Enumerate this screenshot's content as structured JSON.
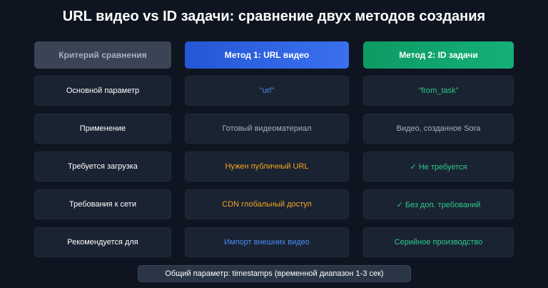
{
  "title": "URL видео vs ID задачи: сравнение двух методов создания",
  "headers": {
    "criteria": "Критерий сравнения",
    "method1": "Метод 1: URL видео",
    "method2": "Метод 2: ID задачи"
  },
  "rows": [
    {
      "criterion": "Основной параметр",
      "m1": "\"url\"",
      "m2": "\"from_task\""
    },
    {
      "criterion": "Применение",
      "m1": "Готовый видеоматериал",
      "m2": "Видео, созданное Sora"
    },
    {
      "criterion": "Требуется загрузка",
      "m1": "Нужен публичный URL",
      "m2": "✓ Не требуется"
    },
    {
      "criterion": "Требования к сети",
      "m1": "CDN глобальный доступ",
      "m2": "✓ Без доп. требований"
    },
    {
      "criterion": "Рекомендуется для",
      "m1": "Импорт внешних видео",
      "m2": "Серийное производство"
    }
  ],
  "footer": "Общий параметр: timestamps (временной диапазон 1-3 сек)",
  "colors": {
    "background": "#0f1520",
    "criteria_header": "#3a4454",
    "method1_header": "#2b5fd9",
    "method2_header": "#10a06a",
    "blue_text": "#4a8cf5",
    "gray_text": "#a8b0bd",
    "orange_text": "#f5a623",
    "green_text": "#2ec98a"
  }
}
